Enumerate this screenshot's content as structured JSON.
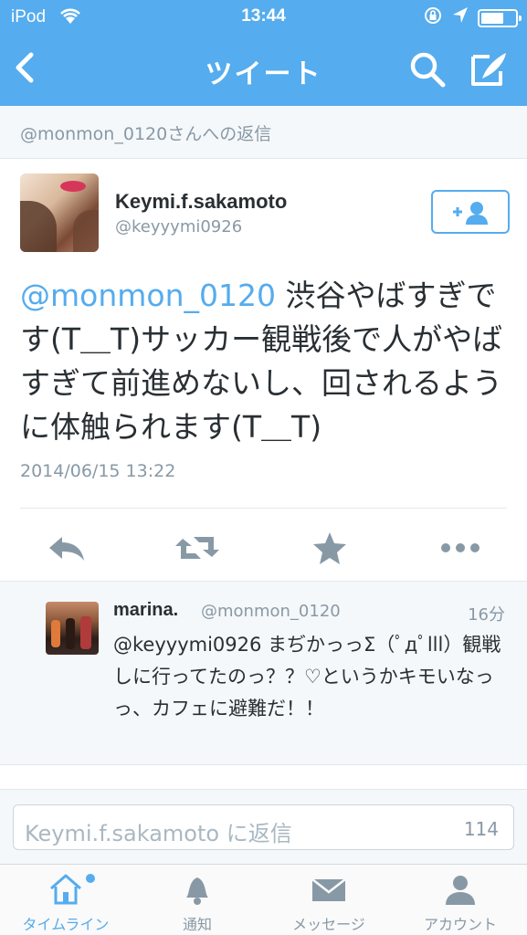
{
  "status_bar": {
    "carrier": "iPod",
    "time": "13:44"
  },
  "nav": {
    "title": "ツイート"
  },
  "context": {
    "text": "@monmon_0120さんへの返信"
  },
  "tweet": {
    "name": "Keymi.f.sakamoto",
    "handle": "@keyyymi0926",
    "mention": "@monmon_0120",
    "body": " 渋谷やばすぎです(T＿T)サッカー観戦後で人がやばすぎて前進めないし、回されるように体触られます(T＿T)",
    "date": "2014/06/15 13:22"
  },
  "reply": {
    "name": "marina.",
    "handle": "@monmon_0120",
    "time": "16分",
    "text": "@keyyymi0926 まぢかっっΣ（ﾟдﾟlll）観戦しに行ってたのっ？？♡というかキモいなっっ、カフェに避難だ！！"
  },
  "compose": {
    "placeholder": "Keymi.f.sakamoto に返信",
    "count": "114"
  },
  "tabs": [
    {
      "label": "タイムライン",
      "icon": "home-icon",
      "active": true
    },
    {
      "label": "通知",
      "icon": "bell-icon",
      "active": false
    },
    {
      "label": "メッセージ",
      "icon": "envelope-icon",
      "active": false
    },
    {
      "label": "アカウント",
      "icon": "person-icon",
      "active": false
    }
  ],
  "colors": {
    "brand": "#55acee",
    "text": "#292f33",
    "muted": "#8899a6"
  }
}
